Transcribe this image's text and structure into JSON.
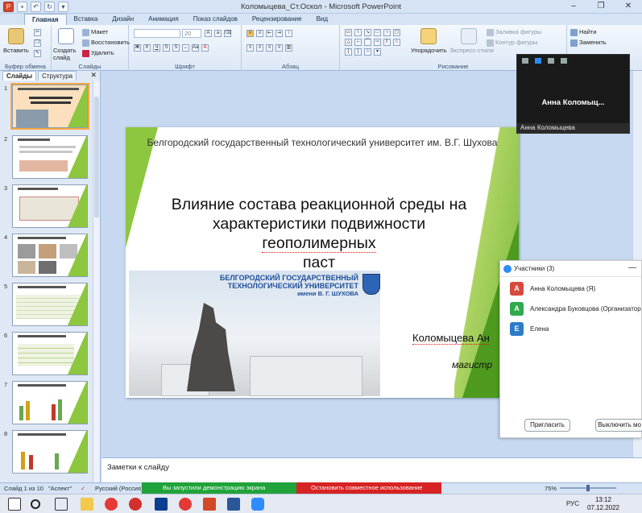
{
  "window": {
    "title": "Коломыцева_Ст.Оскол - Microsoft PowerPoint",
    "min_glyph": "–",
    "max_glyph": "❐",
    "close_glyph": "✕"
  },
  "ribbon_tabs": [
    "Главная",
    "Вставка",
    "Дизайн",
    "Анимация",
    "Показ слайдов",
    "Рецензирование",
    "Вид"
  ],
  "ribbon": {
    "clipboard": {
      "label": "Буфер обмена",
      "paste": "Вставить"
    },
    "slides": {
      "label": "Слайды",
      "new_slide": "Создать слайд",
      "layout": "Макет",
      "reset": "Восстановить",
      "delete": "Удалить"
    },
    "font": {
      "label": "Шрифт",
      "size": "20"
    },
    "paragraph": {
      "label": "Абзац"
    },
    "drawing": {
      "label": "Рисование",
      "arrange": "Упорядочить",
      "quick_styles": "Экспресс-стили",
      "shape_fill": "Заливка фигуры",
      "shape_outline": "Контур фигуры",
      "shape_effects": "Эффекты для фигур"
    },
    "editing": {
      "find": "Найти",
      "replace": "Заменить",
      "select": "Выделить"
    }
  },
  "left_panel": {
    "tabs": [
      "Слайды",
      "Структура"
    ],
    "close": "✕",
    "slide_numbers": [
      "1",
      "2",
      "3",
      "4",
      "5",
      "6",
      "7",
      "8"
    ]
  },
  "slide": {
    "university_header": "Белгородский государственный технологический университет им. В.Г. Шухова",
    "title_line1": "Влияние состава реакционной среды на",
    "title_line2a": "характеристики подвижности ",
    "title_line2b": "геополимерных",
    "title_line3": "паст",
    "banner_line1": "БЕЛГОРОДСКИЙ ГОСУДАРСТВЕННЫЙ",
    "banner_line2": "ТЕХНОЛОГИЧЕСКИЙ УНИВЕРСИТЕТ",
    "banner_line3": "имени В. Г. ШУХОВА",
    "author": "Коломыцева Ан",
    "degree": "магистр"
  },
  "notes": {
    "placeholder": "Заметки к слайду"
  },
  "zoom_video": {
    "name": "Анна  Коломыц...",
    "footer": "Анна Коломыцева"
  },
  "participants": {
    "header": "Участники (3)",
    "minimize": "—",
    "list": [
      {
        "initial": "А",
        "name": "Анна Коломыцева (Я)",
        "color": "#d64a3d"
      },
      {
        "initial": "А",
        "name": "Александра Буковцова (Организатор",
        "color": "#2faa4d"
      },
      {
        "initial": "Е",
        "name": "Елена",
        "color": "#2d7cc8"
      }
    ],
    "invite_button": "Пригласить",
    "mute_button": "Выключить мо"
  },
  "status_bar": {
    "slide_info": "Слайд 1 из 10",
    "theme": "\"Аспект\"",
    "language": "Русский (Россия)",
    "sharing_text": "Вы запустили демонстрацию экрана",
    "stop_sharing": "Остановить совместное использование",
    "zoom": "75%"
  },
  "taskbar": {
    "lang": "РУС",
    "time": "13:12",
    "date": "07.12.2022"
  }
}
